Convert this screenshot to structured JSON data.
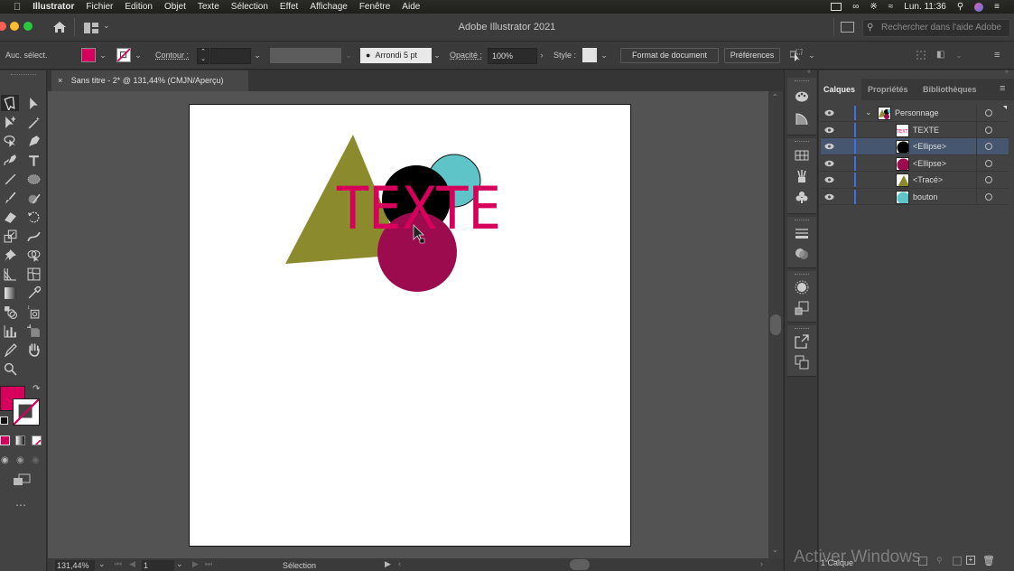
{
  "menubar": {
    "apple": "",
    "app_name": "Illustrator",
    "items": [
      "Fichier",
      "Edition",
      "Objet",
      "Texte",
      "Sélection",
      "Effet",
      "Affichage",
      "Fenêtre",
      "Aide"
    ],
    "clock": "Lun. 11:36"
  },
  "titlebar": {
    "title": "Adobe Illustrator 2021",
    "help_search_placeholder": "Rechercher dans l'aide Adobe"
  },
  "controlbar": {
    "selection_state": "Auc. sélect.",
    "fill_color": "#d6005c",
    "contour_label": "Contour :",
    "contour_value": "",
    "brush_label": "Arrondi 5 pt",
    "opacity_label": "Opacité :",
    "opacity_value": "100%",
    "style_label": "Style :",
    "format_button": "Format de document",
    "preferences_button": "Préférences"
  },
  "document": {
    "tab_title": "Sans titre - 2* @ 131,44% (CMJN/Aperçu)",
    "artwork_text": "TEXTE",
    "colors": {
      "triangle": "#8b8a2c",
      "cyan_circle": "#5fc4c8",
      "black_circle": "#000000",
      "magenta_circle": "#9b0b4e",
      "text": "#d6005c"
    }
  },
  "statusbar": {
    "zoom": "131,44%",
    "artboard_number": "1",
    "tool_state": "Sélection"
  },
  "toolbox": {
    "fill_color": "#d6005c",
    "stroke_color": "none"
  },
  "layers_panel": {
    "tabs": [
      "Calques",
      "Propriétés",
      "Bibliothèques"
    ],
    "active_tab": "Calques",
    "layers": [
      {
        "name": "Personnage",
        "level": 0,
        "expanded": true,
        "selected": false,
        "thumb": "group"
      },
      {
        "name": "TEXTE",
        "level": 1,
        "selected": false,
        "thumb": "text"
      },
      {
        "name": "<Ellipse>",
        "level": 1,
        "selected": true,
        "thumb": "black-circle"
      },
      {
        "name": "<Ellipse>",
        "level": 1,
        "selected": false,
        "thumb": "magenta-circle"
      },
      {
        "name": "<Tracé>",
        "level": 1,
        "selected": false,
        "thumb": "triangle"
      },
      {
        "name": "bouton",
        "level": 1,
        "selected": false,
        "thumb": "cyan-circle"
      }
    ],
    "footer_count": "1 Calque"
  },
  "watermark": "Activer Windows"
}
